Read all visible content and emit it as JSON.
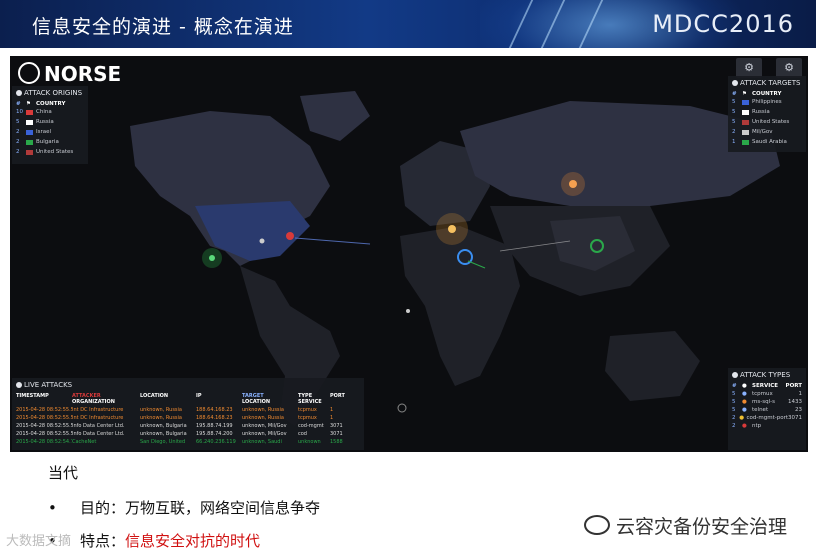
{
  "slide": {
    "title": "信息安全的演进  -  概念在演进",
    "conference_logo": "MDCC2016"
  },
  "map": {
    "brand": "NORSE",
    "attack_origins": {
      "title": "ATTACK ORIGINS",
      "header_country": "COUNTRY",
      "rows": [
        {
          "count": "10",
          "country": "China",
          "color": "#d83a3a"
        },
        {
          "count": "5",
          "country": "Russia",
          "color": "#ffffff"
        },
        {
          "count": "2",
          "country": "Israel",
          "color": "#3a62d8"
        },
        {
          "count": "2",
          "country": "Bulgaria",
          "color": "#2aa84a"
        },
        {
          "count": "2",
          "country": "United States",
          "color": "#b03a3a"
        }
      ]
    },
    "attack_targets": {
      "title": "ATTACK TARGETS",
      "header_country": "COUNTRY",
      "rows": [
        {
          "count": "5",
          "country": "Philippines",
          "color": "#3a62d8"
        },
        {
          "count": "5",
          "country": "Russia",
          "color": "#ffffff"
        },
        {
          "count": "5",
          "country": "United States",
          "color": "#b03a3a"
        },
        {
          "count": "2",
          "country": "Mil/Gov",
          "color": "#cccccc"
        },
        {
          "count": "1",
          "country": "Saudi Arabia",
          "color": "#2aa84a"
        }
      ]
    },
    "attack_types": {
      "title": "ATTACK TYPES",
      "header_service": "SERVICE",
      "header_port": "PORT",
      "rows": [
        {
          "count": "5",
          "service": "tcpmux",
          "port": "1",
          "color": "#8ab2ff"
        },
        {
          "count": "5",
          "service": "ms-sql-s",
          "port": "1433",
          "color": "#f08a30"
        },
        {
          "count": "5",
          "service": "telnet",
          "port": "23",
          "color": "#8ab2ff"
        },
        {
          "count": "2",
          "service": "cod-mgmt-port",
          "port": "3071",
          "color": "#f0c030"
        },
        {
          "count": "2",
          "service": "ntp",
          "port": "",
          "color": "#d83a3a"
        }
      ]
    },
    "live_attacks": {
      "title": "LIVE ATTACKS",
      "headers": {
        "timestamp": "TIMESTAMP",
        "attacker": "ATTACKER",
        "organization": "ORGANIZATION",
        "location": "LOCATION",
        "ip": "IP",
        "target": "TARGET",
        "target_location": "LOCATION",
        "type": "TYPE",
        "service": "SERVICE",
        "port": "PORT"
      },
      "rows": [
        {
          "ts": "2015-04-28 08:52:55.51",
          "org": "Int DC Infrastructure",
          "loc": "unknown, Russia",
          "ip": "188.64.168.23",
          "tloc": "unknown, Russia",
          "svc": "tcpmux",
          "port": "1",
          "color": "#f08a30"
        },
        {
          "ts": "2015-04-28 08:52:55.52",
          "org": "Int DC Infrastructure",
          "loc": "unknown, Russia",
          "ip": "188.64.168.23",
          "tloc": "unknown, Russia",
          "svc": "tcpmux",
          "port": "1",
          "color": "#f08a30"
        },
        {
          "ts": "2015-04-28 08:52:55.52",
          "org": "Info Data Center Ltd.",
          "loc": "unknown, Bulgaria",
          "ip": "195.88.74.199",
          "tloc": "unknown, Mil/Gov",
          "svc": "cod-mgmt",
          "port": "3071",
          "color": "#dddddd"
        },
        {
          "ts": "2015-04-28 08:52:55.52",
          "org": "Info Data Center Ltd.",
          "loc": "unknown, Bulgaria",
          "ip": "195.88.74.200",
          "tloc": "unknown, Mil/Gov",
          "svc": "cod",
          "port": "3071",
          "color": "#dddddd"
        },
        {
          "ts": "2015-04-28 08:52:54.7",
          "org": "CacheNet",
          "loc": "San Diego, United",
          "ip": "66.240.236.119",
          "tloc": "unknown, Saudi",
          "svc": "unknown",
          "port": "1588",
          "color": "#2aa84a"
        }
      ]
    }
  },
  "caption": {
    "heading": "当代",
    "bullets": [
      {
        "marker": "•",
        "label": "目的：",
        "text": "万物互联，网络空间信息争夺",
        "emphasis": false
      },
      {
        "marker": "•",
        "label": "特点：",
        "text": "信息安全对抗的时代",
        "emphasis": true
      }
    ]
  },
  "watermark": {
    "brand": "云容灾备份安全治理",
    "left_text": "大数据文摘"
  }
}
